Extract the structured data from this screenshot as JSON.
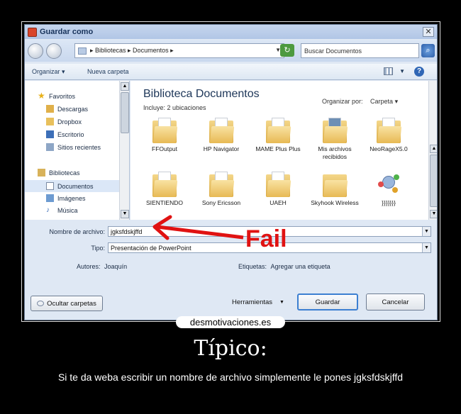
{
  "dialog": {
    "title": "Guardar como",
    "close_label": "✕",
    "address": {
      "breadcrumb": [
        "Bibliotecas",
        "Documentos"
      ],
      "text": "▸ Bibliotecas ▸ Documentos ▸"
    },
    "search": {
      "placeholder": "Buscar Documentos"
    },
    "toolbar": {
      "organize": "Organizar ▾",
      "new_folder": "Nueva carpeta"
    },
    "nav": {
      "items": [
        {
          "label": "Favoritos",
          "icon": "star-icon"
        },
        {
          "label": "Descargas",
          "icon": "downloads-icon"
        },
        {
          "label": "Dropbox",
          "icon": "dropbox-folder-icon"
        },
        {
          "label": "Escritorio",
          "icon": "desktop-icon"
        },
        {
          "label": "Sitios recientes",
          "icon": "recent-places-icon"
        },
        {
          "label": "Bibliotecas",
          "icon": "libraries-icon"
        },
        {
          "label": "Documentos",
          "icon": "documents-icon"
        },
        {
          "label": "Imágenes",
          "icon": "pictures-icon"
        },
        {
          "label": "Música",
          "icon": "music-icon"
        }
      ]
    },
    "library": {
      "title": "Biblioteca Documentos",
      "subtitle": "Incluye: 2 ubicaciones",
      "arrange_label": "Organizar por:",
      "arrange_value": "Carpeta ▾"
    },
    "folders": [
      {
        "label": "FFOutput"
      },
      {
        "label": "HP Navigator"
      },
      {
        "label": "MAME Plus Plus"
      },
      {
        "label": "Mis archivos recibidos"
      },
      {
        "label": "NeoRageX5.0"
      },
      {
        "label": "SIENTIENDO"
      },
      {
        "label": "Sony Ericsson"
      },
      {
        "label": "UAEH"
      },
      {
        "label": "Skyhook Wireless"
      },
      {
        "label": "}}}}}}}"
      }
    ],
    "fields": {
      "filename_label": "Nombre de archivo:",
      "filename_value": "jgksfdskjffd",
      "type_label": "Tipo:",
      "type_value": "Presentación de PowerPoint",
      "authors_label": "Autores:",
      "authors_value": "Joaquín",
      "tags_label": "Etiquetas:",
      "tags_value": "Agregar una etiqueta"
    },
    "footer": {
      "hide_folders": "Ocultar carpetas",
      "tools": "Herramientas",
      "save": "Guardar",
      "cancel": "Cancelar"
    }
  },
  "annotation": {
    "text": "Fail",
    "color": "#e01212"
  },
  "watermark": "desmotivaciones.es",
  "caption": {
    "title": "Típico:",
    "body": "Si te da weba escribir un nombre de archivo simplemente le pones jgksfdskjffd"
  }
}
